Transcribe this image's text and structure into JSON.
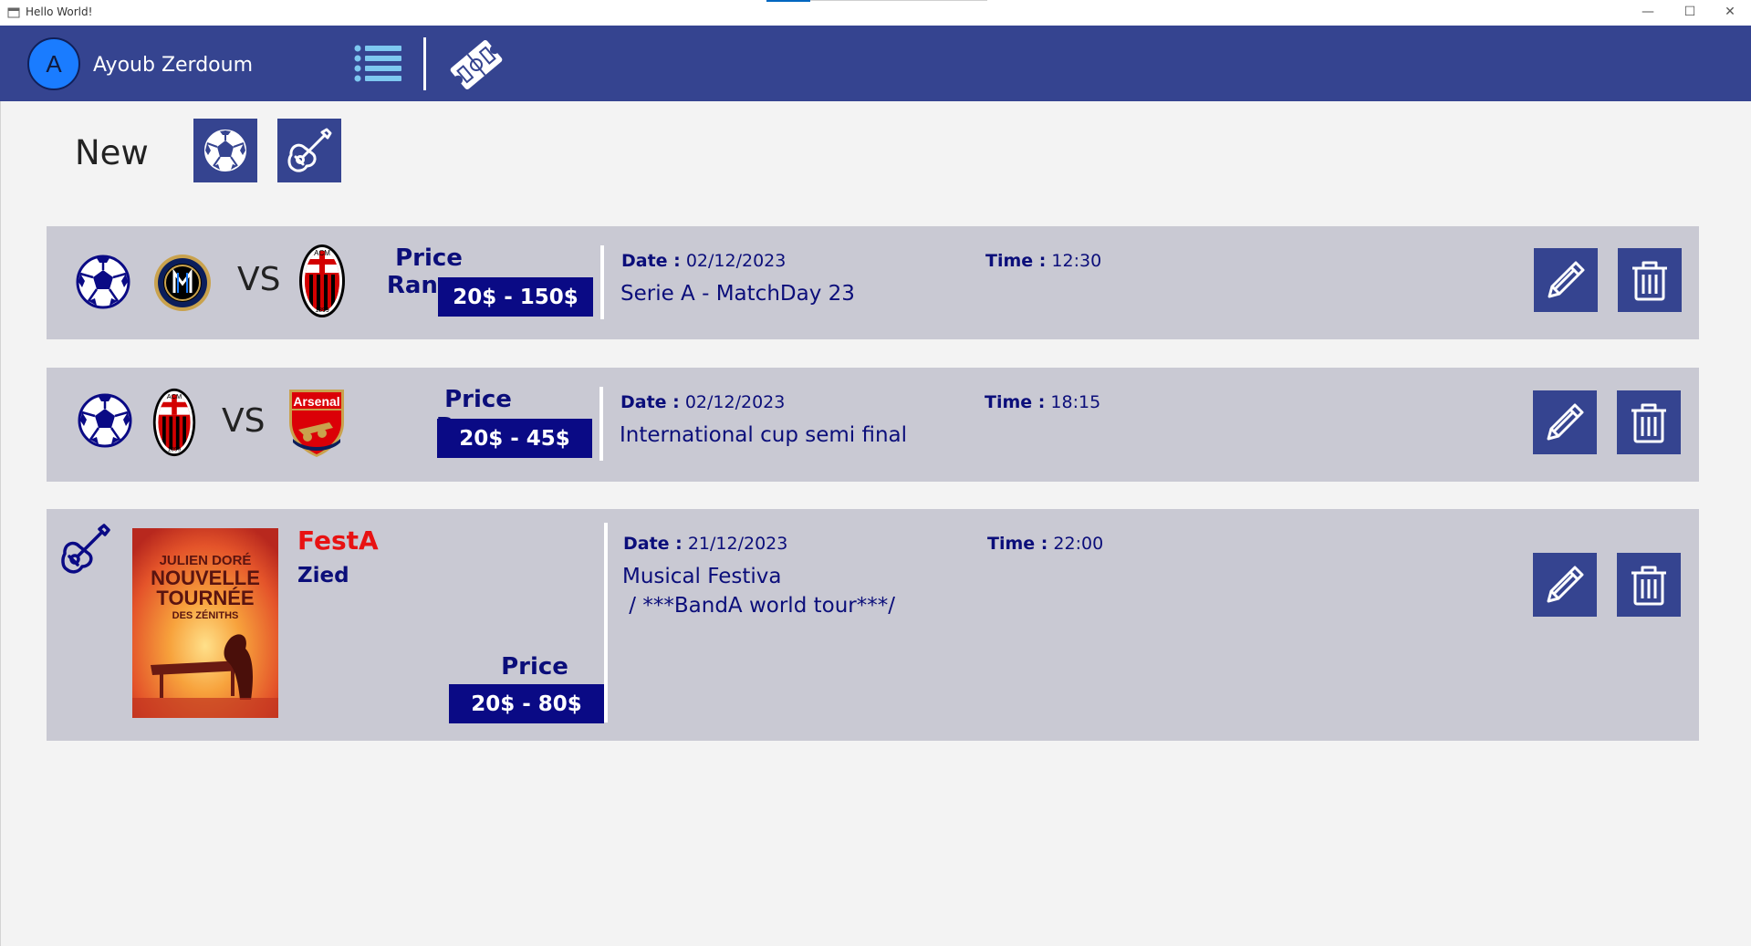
{
  "window": {
    "title": "Hello World!",
    "controls": {
      "minimize": "—",
      "maximize": "☐",
      "close": "✕"
    }
  },
  "header": {
    "avatar_letter": "A",
    "user_name": "Ayoub Zerdoum",
    "icons": [
      "list-icon",
      "ticket-icon"
    ],
    "bg_color": "#354490"
  },
  "toolbar": {
    "new_label": "New",
    "buttons": [
      "soccer-ball-icon",
      "guitar-icon"
    ]
  },
  "events": [
    {
      "kind": "match",
      "icon": "soccer-ball-icon",
      "team_home": "Inter",
      "vs_label": "VS",
      "team_away": "AC Milan",
      "price_label": "Price Range",
      "price": "20$ - 150$",
      "date_key": "Date :",
      "date": "02/12/2023",
      "time_key": "Time :",
      "time": "12:30",
      "description": "Serie A - MatchDay 23"
    },
    {
      "kind": "match",
      "icon": "soccer-ball-icon",
      "team_home": "AC Milan",
      "vs_label": "VS",
      "team_away": "Arsenal",
      "price_label": "Price Range",
      "price": "20$ - 45$",
      "date_key": "Date :",
      "date": "02/12/2023",
      "time_key": "Time :",
      "time": "18:15",
      "description": "International cup semi final"
    },
    {
      "kind": "concert",
      "icon": "guitar-icon",
      "title": "FestA",
      "artist": "Zied",
      "poster_lines": [
        "JULIEN DORÉ",
        "NOUVELLE",
        "TOURNÉE",
        "DES ZÉNITHS"
      ],
      "price_label": "Price Range",
      "price": "20$ - 80$",
      "date_key": "Date :",
      "date": "21/12/2023",
      "time_key": "Time :",
      "time": "22:00",
      "description": "Musical Festiva\n / ***BandA world tour***/"
    }
  ],
  "crests": {
    "milan_text": "ACM",
    "milan_year": "1899",
    "arsenal_text": "Arsenal"
  },
  "colors": {
    "card_bg": "#c9c9d3",
    "price_box": "#0a0a85",
    "accent_text": "#0b0e7a",
    "concert_title": "#e81212"
  }
}
